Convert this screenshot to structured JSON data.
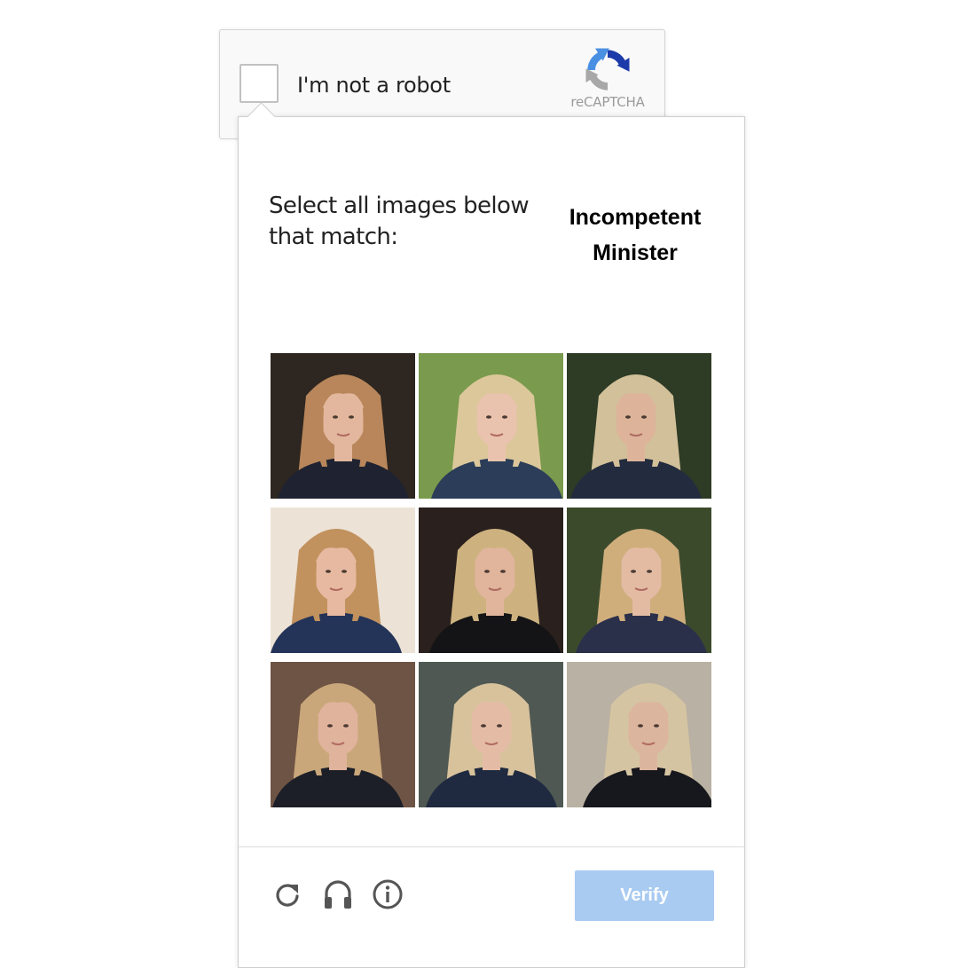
{
  "anchor": {
    "label": "I'm not a robot",
    "logo_text": "reCAPTCHA"
  },
  "challenge": {
    "instruction_line1": "Select all images below",
    "instruction_line2": "that match:",
    "target_line1": "Incompetent",
    "target_line2": "Minister",
    "tiles": [
      {
        "bg": "#2e2620",
        "hair": "#b8865a",
        "skin": "#e3b79d",
        "cloth": "#1f2230"
      },
      {
        "bg": "#7a9a4d",
        "hair": "#dcc79b",
        "skin": "#e9c3ad",
        "cloth": "#2b3d58"
      },
      {
        "bg": "#2e3b25",
        "hair": "#d2c09a",
        "skin": "#ddb49a",
        "cloth": "#232b3e"
      },
      {
        "bg": "#ece2d6",
        "hair": "#c1925e",
        "skin": "#e8b9a1",
        "cloth": "#243458"
      },
      {
        "bg": "#2a201d",
        "hair": "#cdb280",
        "skin": "#e0b59c",
        "cloth": "#141416"
      },
      {
        "bg": "#3c4a2c",
        "hair": "#cfae7c",
        "skin": "#e3bba3",
        "cloth": "#2a2f4a"
      },
      {
        "bg": "#6e5444",
        "hair": "#c9a77a",
        "skin": "#dfb39c",
        "cloth": "#1d1f28"
      },
      {
        "bg": "#4f5852",
        "hair": "#d7c29c",
        "skin": "#e4bca5",
        "cloth": "#1f2a40"
      },
      {
        "bg": "#b9b1a3",
        "hair": "#d5c4a2",
        "skin": "#dcb59e",
        "cloth": "#17181d"
      }
    ]
  },
  "footer": {
    "reload_icon": "reload-icon",
    "audio_icon": "headphones-icon",
    "info_icon": "info-icon",
    "verify_label": "Verify"
  },
  "colors": {
    "verify_bg": "#a9cbf1",
    "logo_blue": "#1c3aa9",
    "logo_lightblue": "#4a90e2",
    "logo_gray": "#a8a8a8"
  }
}
